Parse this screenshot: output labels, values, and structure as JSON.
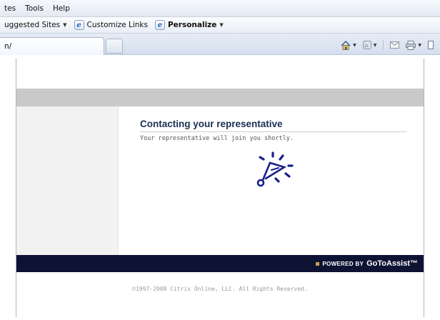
{
  "browser": {
    "menu": [
      "tes",
      "Tools",
      "Help"
    ],
    "favorites": [
      {
        "label": "uggested Sites",
        "has_dropdown": true,
        "icon": null
      },
      {
        "label": "Customize Links",
        "has_dropdown": false,
        "icon": "ie-page-icon"
      },
      {
        "label": "Personalize",
        "has_dropdown": true,
        "icon": "ie-page-icon",
        "bold": true
      }
    ],
    "active_tab_title": "n/",
    "command_icons": [
      "home-icon",
      "feeds-icon",
      "read-mail-icon",
      "print-icon",
      "page-icon"
    ]
  },
  "page": {
    "heading": "Contacting your representative",
    "subtext": "Your representative will join you shortly.",
    "spinner_icon": "loading-spinner-icon",
    "powered_by": "POWERED BY",
    "brand": "GoToAssist™",
    "copyright": "©1997-2008 Citrix Online, LLC. All Rights Reserved."
  },
  "colors": {
    "footer_bar": "#0e1334",
    "heading": "#1b2f52",
    "spinner": "#1a1f8c",
    "gray_band": "#c9c9c9"
  }
}
